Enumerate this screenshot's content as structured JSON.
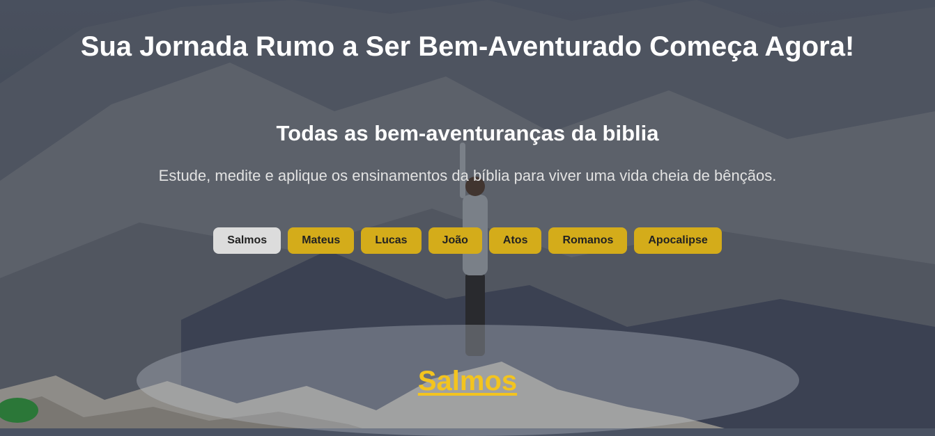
{
  "header": {
    "title": "Sua Jornada Rumo a Ser Bem-Aventurado Começa Agora!"
  },
  "intro": {
    "title": "Todas as bem-aventuranças da biblia",
    "subtitle": "Estude, medite e aplique os ensinamentos da bíblia para viver uma vida cheia de bênçãos."
  },
  "books": {
    "selected": "Salmos",
    "items": [
      {
        "label": "Salmos"
      },
      {
        "label": "Mateus"
      },
      {
        "label": "Lucas"
      },
      {
        "label": "João"
      },
      {
        "label": "Atos"
      },
      {
        "label": "Romanos"
      },
      {
        "label": "Apocalipse"
      }
    ]
  },
  "current_book": {
    "title": "Salmos"
  },
  "colors": {
    "accent": "#d4ac1a",
    "heading_link": "#f3c41f",
    "active_button": "#dcdcdc"
  }
}
